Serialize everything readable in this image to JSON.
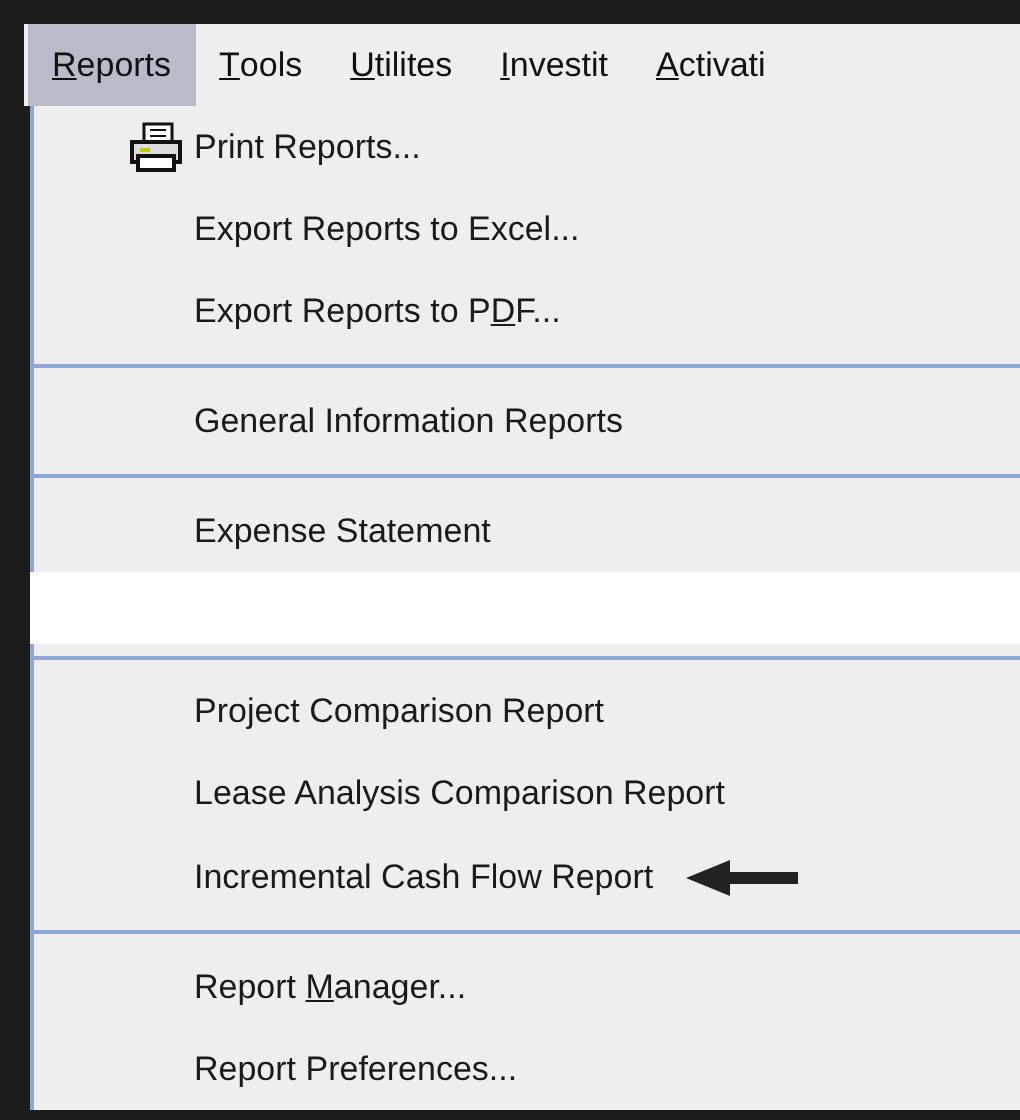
{
  "menubar": [
    {
      "key": "R",
      "after": "eports",
      "selected": true
    },
    {
      "key": "T",
      "after": "ools",
      "selected": false
    },
    {
      "key": "U",
      "after": "tilites",
      "selected": false
    },
    {
      "key": "I",
      "after": "nvestit",
      "selected": false
    },
    {
      "key": "A",
      "after": "ctivati",
      "selected": false
    }
  ],
  "menu": {
    "items": [
      {
        "kind": "icon_item",
        "before": "Print Reports...",
        "pointed": false
      },
      {
        "kind": "item",
        "before": "Export Reports to Excel...",
        "pointed": false
      },
      {
        "kind": "item",
        "before": "Export Reports to P",
        "key": "D",
        "after": "F...",
        "pointed": false
      },
      {
        "kind": "separator"
      },
      {
        "kind": "item",
        "before": "General Information Reports",
        "pointed": false
      },
      {
        "kind": "separator"
      },
      {
        "kind": "item",
        "before": "Expense Statement",
        "pointed": false
      },
      {
        "kind": "blank"
      },
      {
        "kind": "separator"
      },
      {
        "kind": "item",
        "before": "Project Comparison Report",
        "pointed": false
      },
      {
        "kind": "item",
        "before": "Lease Analysis Comparison Report",
        "pointed": false
      },
      {
        "kind": "item",
        "before": "Incremental Cash Flow Report",
        "pointed": true
      },
      {
        "kind": "separator"
      },
      {
        "kind": "item",
        "before": "Report ",
        "key": "M",
        "after": "anager...",
        "pointed": false
      },
      {
        "kind": "item",
        "before": "Report Preferences...",
        "pointed": false
      }
    ]
  }
}
